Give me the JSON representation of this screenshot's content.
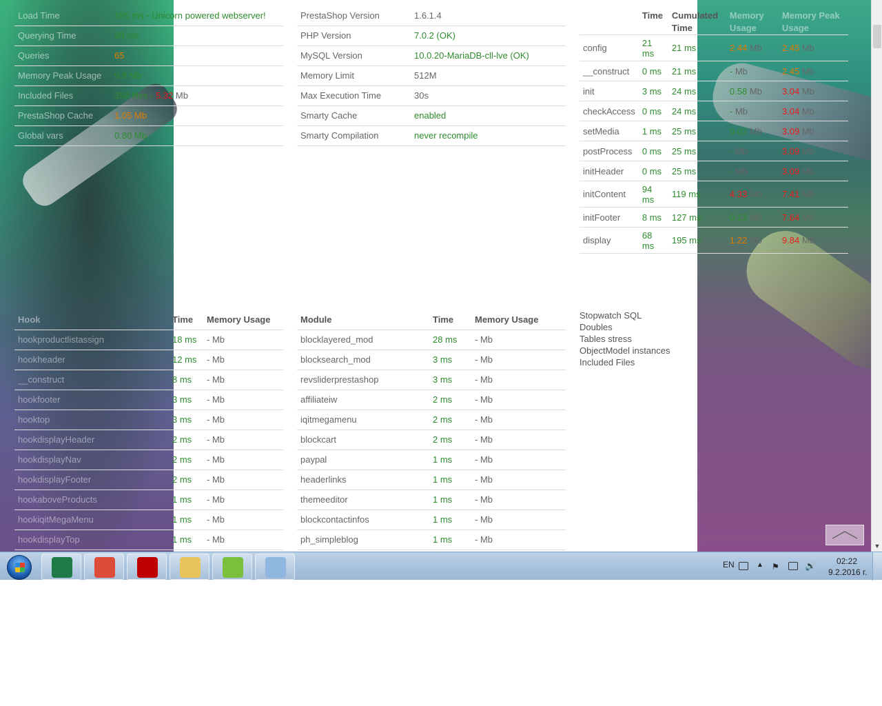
{
  "summary": [
    {
      "k": "Load Time",
      "v": "195 ms - Unicorn powered webserver!",
      "c": "green"
    },
    {
      "k": "Querying Time",
      "v": "30 ms",
      "c": "green"
    },
    {
      "k": "Queries",
      "v": "65",
      "c": "orange"
    },
    {
      "k": "Memory Peak Usage",
      "v": "9.8 Mb",
      "c": "green"
    },
    {
      "k": "Included Files",
      "v": "358 files - ",
      "v2": "5.32",
      "v3": " Mb",
      "c": "green"
    },
    {
      "k": "PrestaShop Cache",
      "v": "1.05 Mb",
      "c": "orange"
    },
    {
      "k": "Global vars",
      "v": "0.80 Mb",
      "c": "green"
    }
  ],
  "versions": [
    {
      "k": "PrestaShop Version",
      "v": "1.6.1.4",
      "c": "gray"
    },
    {
      "k": "PHP Version",
      "v": "7.0.2 (OK)",
      "c": "green"
    },
    {
      "k": "MySQL Version",
      "v": "10.0.20-MariaDB-cll-lve (OK)",
      "c": "green"
    },
    {
      "k": "Memory Limit",
      "v": "512M",
      "c": "gray"
    },
    {
      "k": "Max Execution Time",
      "v": "30s",
      "c": "gray"
    },
    {
      "k": "Smarty Cache",
      "v": "enabled",
      "c": "green"
    },
    {
      "k": "Smarty Compilation",
      "v": "never recompile",
      "c": "green"
    }
  ],
  "stages": {
    "headers": [
      "",
      "Time",
      "Cumulated Time",
      "Memory Usage",
      "Memory Peak Usage"
    ],
    "rows": [
      {
        "name": "config",
        "time": "21 ms",
        "cum": "21 ms",
        "mem": "2.44",
        "memc": "orange",
        "peak": "2.45",
        "peakc": "orange",
        "tall": true
      },
      {
        "name": "__construct",
        "time": "0 ms",
        "cum": "21 ms",
        "mem": "-",
        "memc": "green",
        "peak": "2.45",
        "peakc": "orange"
      },
      {
        "name": "init",
        "time": "3 ms",
        "cum": "24 ms",
        "mem": "0.58",
        "memc": "green",
        "peak": "3.04",
        "peakc": "red"
      },
      {
        "name": "checkAccess",
        "time": "0 ms",
        "cum": "24 ms",
        "mem": "-",
        "memc": "green",
        "peak": "3.04",
        "peakc": "red"
      },
      {
        "name": "setMedia",
        "time": "1 ms",
        "cum": "25 ms",
        "mem": "0.02",
        "memc": "green",
        "peak": "3.09",
        "peakc": "red"
      },
      {
        "name": "postProcess",
        "time": "0 ms",
        "cum": "25 ms",
        "mem": "-",
        "memc": "green",
        "peak": "3.09",
        "peakc": "red"
      },
      {
        "name": "initHeader",
        "time": "0 ms",
        "cum": "25 ms",
        "mem": "-",
        "memc": "green",
        "peak": "3.09",
        "peakc": "red"
      },
      {
        "name": "initContent",
        "time": "94 ms",
        "cum": "119 ms",
        "mem": "4.33",
        "memc": "red",
        "peak": "7.41",
        "peakc": "red",
        "tall": true
      },
      {
        "name": "initFooter",
        "time": "8 ms",
        "cum": "127 ms",
        "mem": "0.13",
        "memc": "green",
        "peak": "7.64",
        "peakc": "red"
      },
      {
        "name": "display",
        "time": "68 ms",
        "cum": "195 ms",
        "mem": "1.22",
        "memc": "orange",
        "peak": "9.84",
        "peakc": "red",
        "tall": true
      }
    ],
    "unit": "Mb"
  },
  "hooks": {
    "headers": [
      "Hook",
      "Time",
      "Memory Usage"
    ],
    "rows": [
      {
        "name": "hookproductlistassign",
        "time": "18 ms",
        "mem": "- Mb"
      },
      {
        "name": "hookheader",
        "time": "12 ms",
        "mem": "- Mb"
      },
      {
        "name": "__construct",
        "time": "8 ms",
        "mem": "- Mb"
      },
      {
        "name": "hookfooter",
        "time": "3 ms",
        "mem": "- Mb"
      },
      {
        "name": "hooktop",
        "time": "3 ms",
        "mem": "- Mb"
      },
      {
        "name": "hookdisplayHeader",
        "time": "2 ms",
        "mem": "- Mb"
      },
      {
        "name": "hookdisplayNav",
        "time": "2 ms",
        "mem": "- Mb"
      },
      {
        "name": "hookdisplayFooter",
        "time": "2 ms",
        "mem": "- Mb"
      },
      {
        "name": "hookaboveProducts",
        "time": "1 ms",
        "mem": "- Mb"
      },
      {
        "name": "hookiqitMegaMenu",
        "time": "1 ms",
        "mem": "- Mb"
      },
      {
        "name": "hookdisplayTop",
        "time": "1 ms",
        "mem": "- Mb"
      }
    ]
  },
  "modules": {
    "headers": [
      "Module",
      "Time",
      "Memory Usage"
    ],
    "rows": [
      {
        "name": "blocklayered_mod",
        "time": "28 ms",
        "mem": "- Mb"
      },
      {
        "name": "blocksearch_mod",
        "time": "3 ms",
        "mem": "- Mb"
      },
      {
        "name": "revsliderprestashop",
        "time": "3 ms",
        "mem": "- Mb"
      },
      {
        "name": "affiliateiw",
        "time": "2 ms",
        "mem": "- Mb"
      },
      {
        "name": "iqitmegamenu",
        "time": "2 ms",
        "mem": "- Mb"
      },
      {
        "name": "blockcart",
        "time": "2 ms",
        "mem": "- Mb"
      },
      {
        "name": "paypal",
        "time": "1 ms",
        "mem": "- Mb"
      },
      {
        "name": "headerlinks",
        "time": "1 ms",
        "mem": "- Mb"
      },
      {
        "name": "themeeditor",
        "time": "1 ms",
        "mem": "- Mb"
      },
      {
        "name": "blockcontactinfos",
        "time": "1 ms",
        "mem": "- Mb"
      },
      {
        "name": "ph_simpleblog",
        "time": "1 ms",
        "mem": "- Mb"
      }
    ]
  },
  "extras": [
    "Stopwatch SQL",
    "Doubles",
    "Tables stress",
    "ObjectModel instances",
    "Included Files"
  ],
  "taskbar": {
    "apps": [
      {
        "name": "excel-icon",
        "color": "#1e7b45"
      },
      {
        "name": "chrome-icon",
        "color": "#dd4b39"
      },
      {
        "name": "filezilla-icon",
        "color": "#bf0000"
      },
      {
        "name": "file-explorer-icon",
        "color": "#e8c25a"
      },
      {
        "name": "notepad-icon",
        "color": "#7bbf3a"
      },
      {
        "name": "paint-icon",
        "color": "#8fb7e0"
      }
    ],
    "lang": "EN",
    "time": "02:22",
    "date": "9.2.2016 г."
  },
  "colors": {
    "green": "#2e8b2e",
    "orange": "#e07b00",
    "red": "#e81c1c",
    "taskbar": "#a9c3de"
  }
}
